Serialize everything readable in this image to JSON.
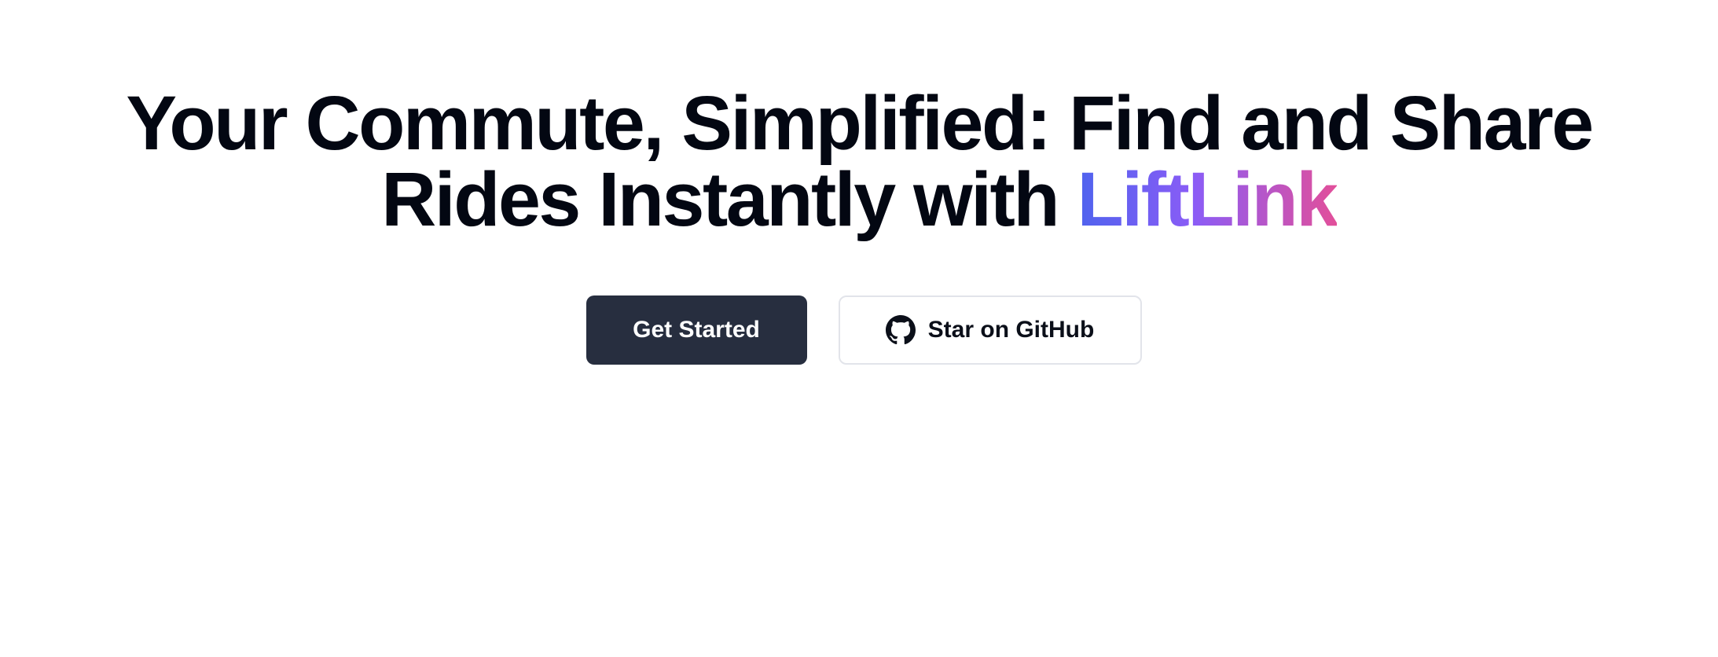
{
  "hero": {
    "headline_line1": "Your Commute, Simplified: Find and Share",
    "headline_line2_prefix": "Rides Instantly with ",
    "brand_name": "LiftLink"
  },
  "actions": {
    "primary_label": "Get Started",
    "secondary_label": "Star on GitHub",
    "secondary_icon": "github-icon"
  },
  "colors": {
    "headline": "#030712",
    "primary_button_bg": "#272e3f",
    "brand_gradient_start": "#4f63ee",
    "brand_gradient_mid": "#8b5cf6",
    "brand_gradient_end": "#e24f9a"
  }
}
